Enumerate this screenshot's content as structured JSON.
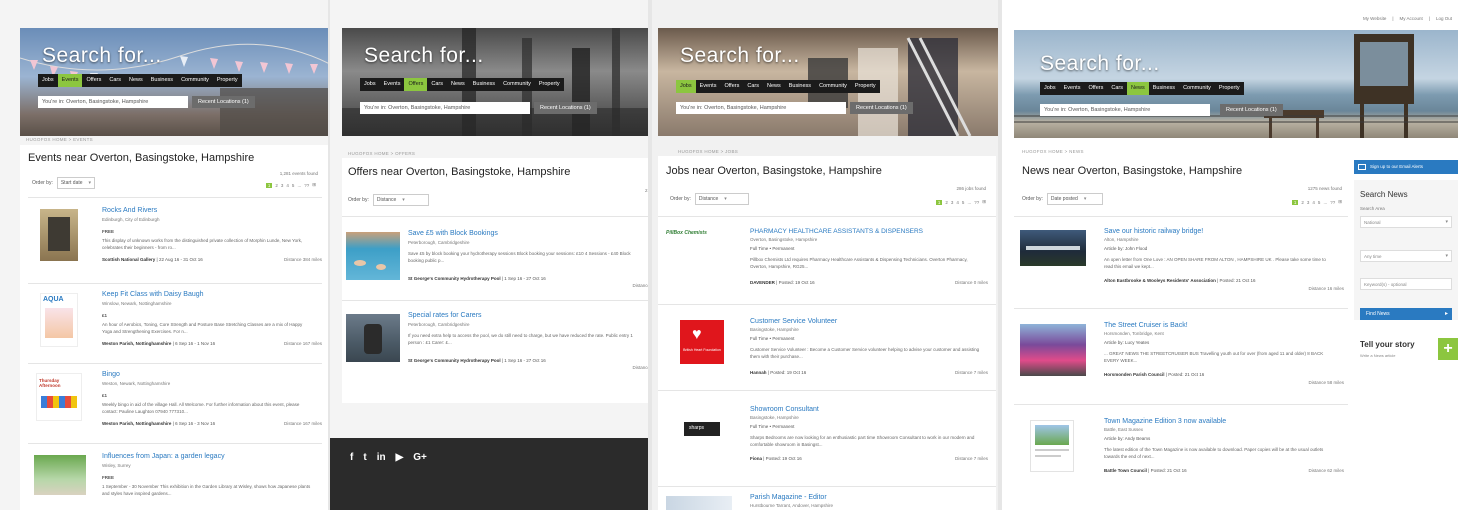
{
  "panels": [
    {
      "hero_title": "Search for...",
      "nav": [
        "Jobs",
        "Events",
        "Offers",
        "Cars",
        "News",
        "Business",
        "Community",
        "Property"
      ],
      "active_nav": "Events",
      "location": "You're in: Overton, Basingstoke, Hampshire",
      "recent": "Recent Locations (1)",
      "breadcrumb": "HUGOFOX HOME  >  EVENTS",
      "title": "Events near Overton, Basingstoke, Hampshire",
      "found": "1,281 events found",
      "order_label": "Order by:",
      "order_value": "Start date",
      "pager": [
        "1",
        "2",
        "3",
        "4",
        "5",
        "...",
        "??",
        "⊞"
      ],
      "items": [
        {
          "title": "Rocks And Rivers",
          "location": "Edinburgh, City of Edinburgh",
          "meta": "FREE",
          "desc": "This display of unknown works from the distinguished private collection of Morphin Lunde, New York, celebrates their beginners - from ro...",
          "foot": "Scottish National Gallery",
          "date": "22 Aug 16 - 31 Oct 16",
          "dist": "Distance 384 miles"
        },
        {
          "title": "Keep Fit Class with Daisy Baugh",
          "location": "Winslow, Newark, Nottinghamshire",
          "meta": "£1",
          "desc": "An hour of Aerobics, Toning, Core Strength and Posture Base Stretching Classes are a mix of Happy Yoga and Strengthening Exercises. For n...",
          "foot": "Weston Parish, Nottinghamshire",
          "date": "6 Sep 16 - 1 Nov 16",
          "dist": "Distance 167 miles"
        },
        {
          "title": "Bingo",
          "location": "Weston, Newark, Nottinghamshire",
          "meta": "£1",
          "desc": "Weekly bingo in aid of the village Hall. All Welcome. For further information about this event, please contact: Pauline Laughton 07940 777310...",
          "foot": "Weston Parish, Nottinghamshire",
          "date": "6 Sep 16 - 3 Nov 16",
          "dist": "Distance 167 miles"
        },
        {
          "title": "Influences from Japan: a garden legacy",
          "location": "Wisley, Surrey",
          "meta": "FREE",
          "desc": "1 September - 30 November This exhibition in the Garden Library at Wisley, shows how Japanese plants and styles have inspired gardens...",
          "foot": "",
          "date": "",
          "dist": ""
        }
      ],
      "thumb_labels": [
        "",
        "AQUA",
        "Thursday Afternoon",
        ""
      ]
    },
    {
      "hero_title": "Search for...",
      "nav": [
        "Jobs",
        "Events",
        "Offers",
        "Cars",
        "News",
        "Business",
        "Community",
        "Property"
      ],
      "active_nav": "Offers",
      "location": "You're in: Overton, Basingstoke, Hampshire",
      "recent": "Recent Locations (1)",
      "breadcrumb": "HUGOFOX HOME  >  OFFERS",
      "title": "Offers near Overton, Basingstoke, Hampshire",
      "found": "21",
      "order_label": "Order by:",
      "order_value": "Distance",
      "items": [
        {
          "title": "Save £5 with Block Bookings",
          "location": "Peterborough, Cambridgeshire",
          "desc": "Save £5 by block booking your hydrotherapy sessions Block booking your sessions: £10 4 Sessions - £40 Block booking public p...",
          "foot": "St George's Community Hydrotherapy Pool",
          "date": "1 Sep 16 - 27 Oct 16",
          "dist": "Distance"
        },
        {
          "title": "Special rates for Carers",
          "location": "Peterborough, Cambridgeshire",
          "desc": "If you need extra help to access the pool, we do still need to charge, but we have reduced the rate. Public entry 1 person : £1 Carer: £...",
          "foot": "St George's Community Hydrotherapy Pool",
          "date": "1 Sep 16 - 27 Oct 16",
          "dist": "Distance"
        }
      ],
      "social": [
        "f",
        "t",
        "in",
        "▶",
        "G+"
      ]
    },
    {
      "hero_title": "Search for...",
      "nav": [
        "Jobs",
        "Events",
        "Offers",
        "Cars",
        "News",
        "Business",
        "Community",
        "Property"
      ],
      "active_nav": "Jobs",
      "location": "You're in: Overton, Basingstoke, Hampshire",
      "recent": "Recent Locations (1)",
      "breadcrumb": "HUGOFOX HOME  >  JOBS",
      "title": "Jobs near Overton, Basingstoke, Hampshire",
      "found": "286 jobs found",
      "order_label": "Order by:",
      "order_value": "Distance",
      "pager": [
        "1",
        "2",
        "3",
        "4",
        "5",
        "...",
        "??",
        "⊞"
      ],
      "items": [
        {
          "title": "PHARMACY HEALTHCARE ASSISTANTS & DISPENSERS",
          "location": "Overton, Basingstoke, Hampshire",
          "meta": "Full Time  •  Permanent",
          "desc": "Pillbox Chemists Ltd requires Pharmacy Healthcare Assistants & Dispensing Technicians. Overton Pharmacy, Overton, Hampshire, RG25...",
          "foot": "DAVENDER",
          "date": "Posted: 19 Oct 16",
          "dist": "Distance 0 miles",
          "logo": "PillBox Chemists"
        },
        {
          "title": "Customer Service Volunteer",
          "location": "Basingstoke, Hampshire",
          "meta": "Full Time  •  Permanent",
          "desc": "Customer Service Volunteer : Become a Customer Service volunteer helping to advise your customer and assisting them with their purchase...",
          "foot": "Hannah",
          "date": "Posted: 19 Oct 16",
          "dist": "Distance 7 miles",
          "logo": "British Heart Foundation"
        },
        {
          "title": "Showroom Consultant",
          "location": "Basingstoke, Hampshire",
          "meta": "Full Time  •  Permanent",
          "desc": "Sharps Bedrooms are now looking for an enthusiastic part time Showroom Consultant to work in our modern and comfortable showroom in Basingst...",
          "foot": "Fiona",
          "date": "Posted: 19 Oct 16",
          "dist": "Distance 7 miles",
          "logo": "sharps"
        },
        {
          "title": "Parish Magazine - Editor",
          "location": "Hurstbourne Tarrant, Andover, Hampshire",
          "meta": "",
          "desc": "",
          "foot": "",
          "date": "",
          "dist": "",
          "logo": ""
        }
      ]
    },
    {
      "toplinks": [
        "My Website",
        "My Account",
        "Log Out"
      ],
      "hero_title": "Search for...",
      "nav": [
        "Jobs",
        "Events",
        "Offers",
        "Cars",
        "News",
        "Business",
        "Community",
        "Property"
      ],
      "active_nav": "News",
      "location": "You're in: Overton, Basingstoke, Hampshire",
      "recent": "Recent Locations (1)",
      "breadcrumb": "HUGOFOX HOME  >  NEWS",
      "title": "News near Overton, Basingstoke, Hampshire",
      "found": "1275 news found",
      "order_label": "Order by:",
      "order_value": "Date posted",
      "pager": [
        "1",
        "2",
        "3",
        "4",
        "5",
        "...",
        "??",
        "⊞"
      ],
      "items": [
        {
          "title": "Save our historic railway bridge!",
          "location": "Alton, Hampshire",
          "meta": "Article by: John Flood",
          "desc": "An open letter from One Love : AN OPEN SHARE FROM ALTON , HAMPSHIRE UK . Please take some time to read this email we kept...",
          "foot": "Alton Eastbrooke & Wooleys Residents' Association",
          "date": "Posted: 21 Oct 16",
          "dist": "Distance 16 miles"
        },
        {
          "title": "The Street Cruiser is Back!",
          "location": "Horsmonden, Tonbridge, Kent",
          "meta": "Article by: Lucy Yeates",
          "desc": "... GREAT NEWS THE STREETCRUISER BUS Travelling youth out for over (from aged 11 and older) 8 BACK EVERY WEEK...",
          "foot": "Horsmonden Parish Council",
          "date": "Posted: 21 Oct 16",
          "dist": "Distance 58 miles"
        },
        {
          "title": "Town Magazine Edition 3 now available",
          "location": "Battle, East Sussex",
          "meta": "Article by: Andy Beams",
          "desc": "The latest edition of the Town Magazine is now available to download. Paper copies will be at the usual outlets towards the end of next...",
          "foot": "Battle Town Council",
          "date": "Posted: 21 Oct 16",
          "dist": "Distance 62 miles"
        }
      ],
      "sidebar": {
        "email": "Sign up to our Email Alerts",
        "heading": "Search News",
        "area_label": "Search Area",
        "area_value": "National",
        "time_value": "Any time",
        "keyword_placeholder": "Keyword(s) - optional",
        "button": "Find News",
        "tell": "Tell your story",
        "tell_sub": "Write a News article"
      }
    }
  ],
  "colors": {
    "accent_green": "#8cc63f",
    "link_blue": "#2a7ac1",
    "nav_dark": "#1b1b1b",
    "footer_dark": "#2b2b2b"
  }
}
